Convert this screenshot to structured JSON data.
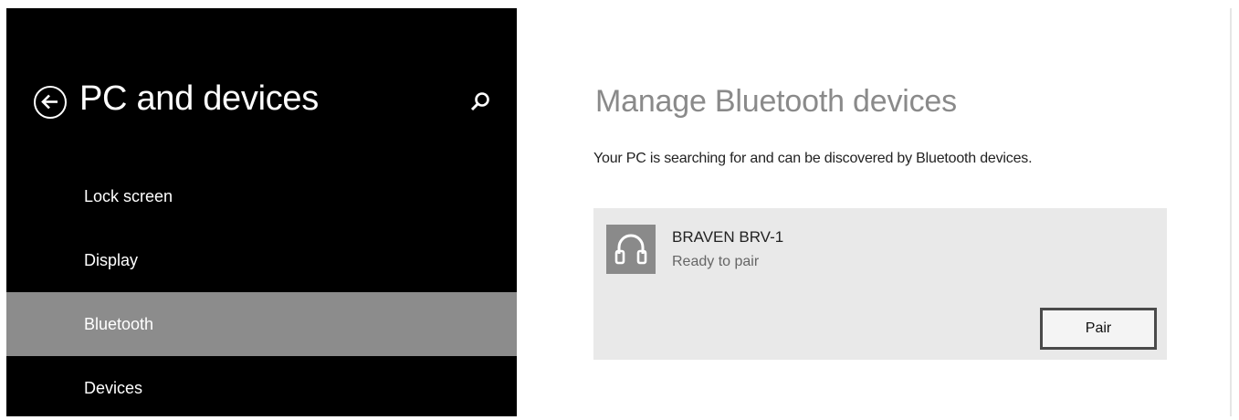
{
  "sidebar": {
    "title": "PC and devices",
    "items": [
      {
        "label": "Lock screen",
        "selected": false
      },
      {
        "label": "Display",
        "selected": false
      },
      {
        "label": "Bluetooth",
        "selected": true
      },
      {
        "label": "Devices",
        "selected": false
      }
    ]
  },
  "main": {
    "title": "Manage Bluetooth devices",
    "status_text": "Your PC is searching for and can be discovered by Bluetooth devices.",
    "device": {
      "name": "BRAVEN BRV-1",
      "status": "Ready to pair",
      "icon": "headset-icon",
      "pair_label": "Pair"
    }
  },
  "colors": {
    "sidebar_bg": "#000000",
    "selected_bg": "#8c8c8c",
    "card_bg": "#e9e9e9",
    "title_gray": "#8a8a8a"
  }
}
